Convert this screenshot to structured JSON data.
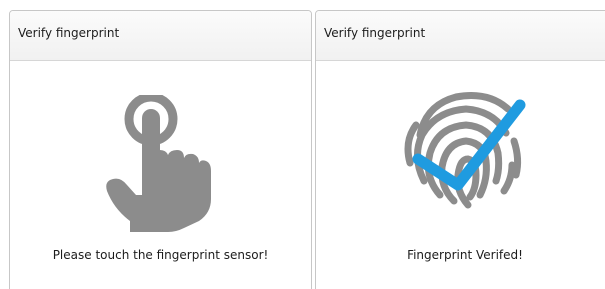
{
  "dialogs": [
    {
      "title": "Verify fingerprint",
      "message": "Please touch the fingerprint sensor!",
      "icon": "touch-finger-icon"
    },
    {
      "title": "Verify fingerprint",
      "message": "Fingerprint Verifed!",
      "icon": "fingerprint-verified-icon"
    }
  ],
  "colors": {
    "icon_gray": "#8c8c8c",
    "check_blue": "#1f9be0"
  }
}
